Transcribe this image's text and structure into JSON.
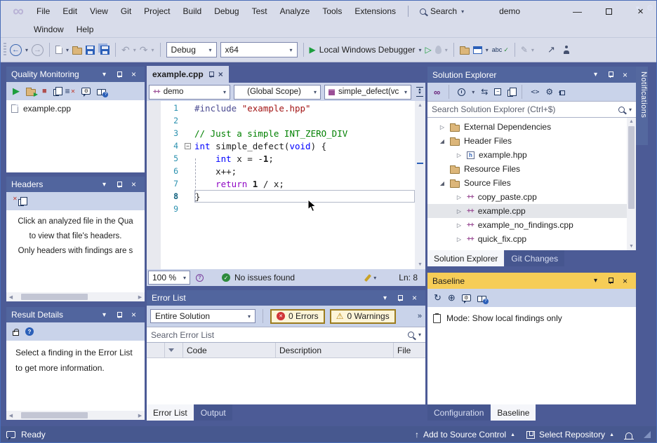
{
  "icons": {
    "infinity": "∞",
    "chevron_down": "▾",
    "tree_collapsed": "▷",
    "tree_expanded": "◢",
    "close": "×",
    "minimize": "—",
    "play": "▶",
    "play_outline": "▷",
    "stop": "■",
    "warning": "⚠",
    "back": "←",
    "forward": "→",
    "undo": "↶",
    "redo": "↷",
    "pencil": "✎",
    "share": "↗",
    "gear": "⚙",
    "sync": "⇆",
    "list": "≡",
    "code": "<>",
    "refresh": "↻",
    "globe": "⊕",
    "overflow": "»",
    "scroll_up": "▲",
    "scroll_down": "▼",
    "scroll_left": "◀",
    "scroll_right": "▶",
    "check": "✓",
    "cross": "✕",
    "help": "?",
    "minus": "−",
    "up_arrow": "↑",
    "caret_up": "▲",
    "cpp_badge": "++",
    "hpp_badge": "h"
  },
  "titlebar": {
    "menu_row1": [
      "File",
      "Edit",
      "View",
      "Git",
      "Project",
      "Build",
      "Debug",
      "Test",
      "Analyze",
      "Tools",
      "Extensions"
    ],
    "menu_row2": [
      "Window",
      "Help"
    ],
    "search_label": "Search",
    "window_title": "demo"
  },
  "toolbar": {
    "config_selector": "Debug",
    "platform_selector": "x64",
    "debug_target": "Local Windows Debugger",
    "spellcheck_label": "abc"
  },
  "quality_monitoring": {
    "title": "Quality Monitoring",
    "files": [
      "example.cpp"
    ]
  },
  "headers_panel": {
    "title": "Headers",
    "message_lines": [
      "Click an analyzed file in the Qua",
      "to view that file's headers.",
      "Only headers with findings are s"
    ]
  },
  "result_details": {
    "title": "Result Details",
    "message_lines": [
      "Select a finding in the Error List",
      "to get more information."
    ]
  },
  "editor": {
    "tab_label": "example.cpp",
    "project_dropdown": "demo",
    "scope_dropdown": "(Global Scope)",
    "symbol_dropdown": "simple_defect(vc",
    "zoom_level": "100 %",
    "status_message": "No issues found",
    "line_indicator": "Ln: 8",
    "code_lines": [
      {
        "n": "1",
        "segs": [
          {
            "c": "pre",
            "t": "#include "
          },
          {
            "c": "str",
            "t": "\"example.hpp\""
          }
        ]
      },
      {
        "n": "2",
        "segs": []
      },
      {
        "n": "3",
        "segs": [
          {
            "c": "com",
            "t": "// Just a simple INT_ZERO_DIV"
          }
        ]
      },
      {
        "n": "4",
        "fold": true,
        "segs": [
          {
            "c": "kw",
            "t": "int"
          },
          {
            "c": "pln",
            "t": " simple_defect("
          },
          {
            "c": "kw",
            "t": "void"
          },
          {
            "c": "pln",
            "t": ") {"
          }
        ]
      },
      {
        "n": "5",
        "segs": [
          {
            "c": "pln",
            "t": "    "
          },
          {
            "c": "kw",
            "t": "int"
          },
          {
            "c": "pln",
            "t": " x = -"
          },
          {
            "c": "num",
            "t": "1"
          },
          {
            "c": "pln",
            "t": ";"
          }
        ]
      },
      {
        "n": "6",
        "segs": [
          {
            "c": "pln",
            "t": "    x++;"
          }
        ]
      },
      {
        "n": "7",
        "segs": [
          {
            "c": "pln",
            "t": "    "
          },
          {
            "c": "ctl",
            "t": "return"
          },
          {
            "c": "pln",
            "t": " "
          },
          {
            "c": "num",
            "t": "1"
          },
          {
            "c": "pln",
            "t": " / x;"
          }
        ]
      },
      {
        "n": "8",
        "current": true,
        "segs": [
          {
            "c": "pln",
            "t": "}"
          }
        ]
      },
      {
        "n": "9",
        "segs": []
      }
    ]
  },
  "error_list": {
    "title": "Error List",
    "scope_filter": "Entire Solution",
    "errors_button": "0 Errors",
    "warnings_button": "0 Warnings",
    "search_placeholder": "Search Error List",
    "columns": [
      "Code",
      "Description",
      "File"
    ],
    "tabs": [
      {
        "label": "Error List",
        "active": true
      },
      {
        "label": "Output",
        "active": false
      }
    ]
  },
  "solution_explorer": {
    "title": "Solution Explorer",
    "search_placeholder": "Search Solution Explorer (Ctrl+$)",
    "items": [
      {
        "label": "External Dependencies",
        "icon": "folder",
        "arrow": "collapsed",
        "indent": 0
      },
      {
        "label": "Header Files",
        "icon": "folder",
        "arrow": "expanded",
        "indent": 0
      },
      {
        "label": "example.hpp",
        "icon": "hpp",
        "arrow": "collapsed",
        "indent": 1
      },
      {
        "label": "Resource Files",
        "icon": "folder",
        "arrow": "none",
        "indent": 0
      },
      {
        "label": "Source Files",
        "icon": "folder",
        "arrow": "expanded",
        "indent": 0
      },
      {
        "label": "copy_paste.cpp",
        "icon": "cpp",
        "arrow": "collapsed",
        "indent": 1
      },
      {
        "label": "example.cpp",
        "icon": "cpp",
        "arrow": "collapsed",
        "indent": 1,
        "selected": true
      },
      {
        "label": "example_no_findings.cpp",
        "icon": "cpp",
        "arrow": "collapsed",
        "indent": 1
      },
      {
        "label": "quick_fix.cpp",
        "icon": "cpp",
        "arrow": "collapsed",
        "indent": 1
      }
    ],
    "tabs": [
      {
        "label": "Solution Explorer",
        "active": true
      },
      {
        "label": "Git Changes",
        "active": false
      }
    ]
  },
  "baseline_panel": {
    "title": "Baseline",
    "mode_text": "Mode: Show local findings only",
    "tabs": [
      {
        "label": "Configuration",
        "active": false
      },
      {
        "label": "Baseline",
        "active": true
      }
    ]
  },
  "notifications_tab": {
    "label": "Notifications"
  },
  "status_bar": {
    "ready": "Ready",
    "add_to_source_control": "Add to Source Control",
    "select_repository": "Select Repository"
  },
  "colors": {
    "accent_gold": "#f6cd57",
    "chrome": "#d8dcea",
    "dock_bg": "#4c5b96",
    "status_bg": "#47588f"
  }
}
